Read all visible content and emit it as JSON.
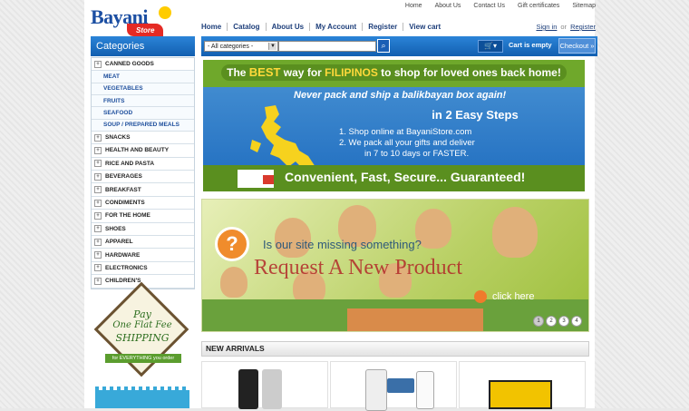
{
  "logo": {
    "word": "Bayani",
    "sub": "Store"
  },
  "top_links": [
    "Home",
    "About Us",
    "Contact Us",
    "Gift certificates",
    "Sitemap"
  ],
  "main_nav": [
    "Home",
    "Catalog",
    "About Us",
    "My Account",
    "Register",
    "View cart"
  ],
  "account": {
    "sign_in": "Sign in",
    "or": "or",
    "register": "Register"
  },
  "categories_title": "Categories",
  "search": {
    "category_value": "- All categories -",
    "placeholder": ""
  },
  "cart": {
    "status": "Cart is empty",
    "checkout_label": "Checkout »"
  },
  "categories": [
    {
      "label": "CANNED GOODS",
      "type": "parent",
      "expanded": true
    },
    {
      "label": "MEAT",
      "type": "child"
    },
    {
      "label": "VEGETABLES",
      "type": "child"
    },
    {
      "label": "FRUITS",
      "type": "child"
    },
    {
      "label": "SEAFOOD",
      "type": "child"
    },
    {
      "label": "SOUP / PREPARED MEALS",
      "type": "child"
    },
    {
      "label": "SNACKS",
      "type": "parent"
    },
    {
      "label": "HEALTH AND BEAUTY",
      "type": "parent"
    },
    {
      "label": "RICE AND PASTA",
      "type": "parent"
    },
    {
      "label": "BEVERAGES",
      "type": "parent"
    },
    {
      "label": "BREAKFAST",
      "type": "parent"
    },
    {
      "label": "CONDIMENTS",
      "type": "parent"
    },
    {
      "label": "FOR THE HOME",
      "type": "parent"
    },
    {
      "label": "SHOES",
      "type": "parent"
    },
    {
      "label": "APPAREL",
      "type": "parent"
    },
    {
      "label": "HARDWARE",
      "type": "parent"
    },
    {
      "label": "ELECTRONICS",
      "type": "parent"
    },
    {
      "label": "CHILDREN'S",
      "type": "parent"
    }
  ],
  "promo": {
    "line1": "Pay",
    "line2": "One Flat Fee",
    "line3": "SHIPPING",
    "ribbon": "for EVERYTHING you order"
  },
  "banner1": {
    "headline_pre": "The ",
    "headline_best": "BEST",
    "headline_mid": " way for ",
    "headline_fil": "FILIPINOS",
    "headline_post": " to shop for loved ones back home!",
    "tagline": "Never pack and ship a balikbayan box again!",
    "steps_title": "in 2 Easy Steps",
    "step1": "1.  Shop online at BayaniStore.com",
    "step2": "2.  We pack all your gifts and deliver",
    "step2b": "in 7 to 10 days or FASTER.",
    "footer": "Convenient, Fast,  Secure... Guaranteed!"
  },
  "banner2": {
    "question": "Is our site missing something?",
    "request": "Request  A New Product",
    "click": "click here",
    "pages": [
      "1",
      "2",
      "3",
      "4"
    ],
    "active_page": "1"
  },
  "new_arrivals_title": "NEW ARRIVALS",
  "colors": {
    "brand_blue": "#1b5fb5",
    "banner_green": "#5a8f1f",
    "request_red": "#b22a2a"
  }
}
